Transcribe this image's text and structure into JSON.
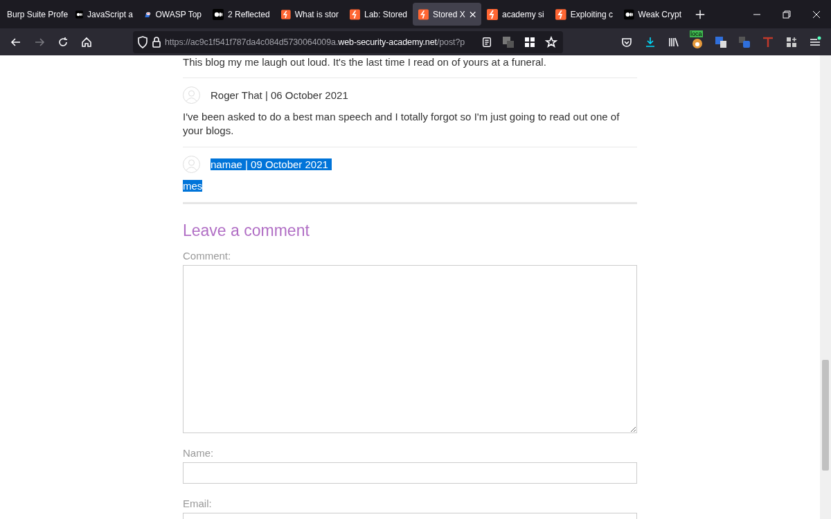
{
  "tabs": [
    {
      "label": "Burp Suite Profe",
      "kind": "plain",
      "selected": false
    },
    {
      "label": "JavaScript a",
      "kind": "dots",
      "selected": false
    },
    {
      "label": "OWASP Top",
      "kind": "robot",
      "selected": false
    },
    {
      "label": "2 Reflected",
      "kind": "dots",
      "selected": false
    },
    {
      "label": "What is stor",
      "kind": "bolt",
      "selected": false
    },
    {
      "label": "Lab: Stored",
      "kind": "bolt",
      "selected": false
    },
    {
      "label": "Stored X",
      "kind": "bolt",
      "selected": true
    },
    {
      "label": "academy si",
      "kind": "bolt",
      "selected": false
    },
    {
      "label": "Exploiting c",
      "kind": "bolt",
      "selected": false
    },
    {
      "label": "Weak Crypt",
      "kind": "dots",
      "selected": false
    }
  ],
  "address": {
    "prefix": "https://ac9c1f541f787da4c084d5730064009a.",
    "domain": "web-security-academy.net",
    "path": "/post?p"
  },
  "extension_badge": "loca",
  "comments": [
    {
      "text": "This blog my me laugh out loud. It's the last time I read on of yours at a funeral.",
      "highlighted": false
    },
    {
      "author": "Roger That | 06 October 2021",
      "text": "I've been asked to do a best man speech and I totally forgot so I'm just going to read out one of your blogs.",
      "highlighted": false
    },
    {
      "author": "namae | 09 October 2021",
      "text": "mes",
      "highlighted": true
    }
  ],
  "form": {
    "heading": "Leave a comment",
    "fields": [
      {
        "label": "Comment:",
        "kind": "textarea"
      },
      {
        "label": "Name:",
        "kind": "input"
      },
      {
        "label": "Email:",
        "kind": "input"
      }
    ]
  }
}
